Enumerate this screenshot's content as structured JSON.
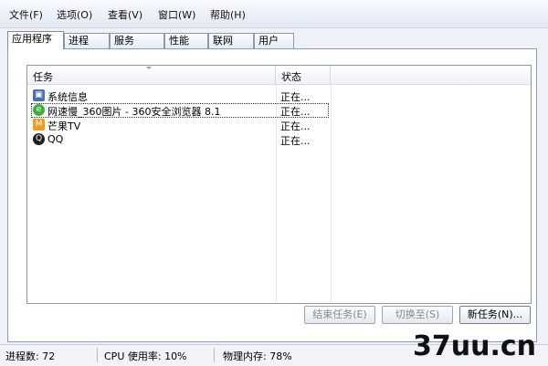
{
  "menu": [
    "文件(F)",
    "选项(O)",
    "查看(V)",
    "窗口(W)",
    "帮助(H)"
  ],
  "tabs": [
    "应用程序",
    "进程",
    "服务",
    "性能",
    "联网",
    "用户"
  ],
  "list": {
    "columns": {
      "task": "任务",
      "status": "状态"
    },
    "rows": [
      {
        "name": "系统信息",
        "status": "正在...",
        "icon": "system-info-icon",
        "color": "#4a6fb5"
      },
      {
        "name": "网速慢_360图片 - 360安全浏览器 8.1",
        "status": "正在...",
        "icon": "360-browser-icon",
        "color": "#3fae3a"
      },
      {
        "name": "芒果TV",
        "status": "正在...",
        "icon": "mango-tv-icon",
        "color": "#f29a1d"
      },
      {
        "name": "QQ",
        "status": "正在...",
        "icon": "qq-penguin-icon",
        "color": "#1e1e1e"
      }
    ]
  },
  "buttons": {
    "end_task": "结束任务(E)",
    "switch_to": "切换至(S)",
    "new_task": "新任务(N)..."
  },
  "statusbar": {
    "processes": "进程数: 72",
    "cpu": "CPU 使用率: 10%",
    "memory": "物理内存: 78%"
  },
  "watermark": "37uu.cn"
}
